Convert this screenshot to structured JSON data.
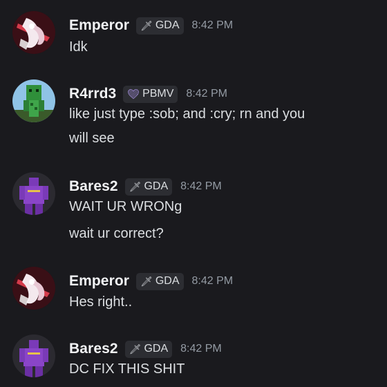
{
  "messages": [
    {
      "username": "Emperor",
      "tag_icon": "sword-icon",
      "tag": "GDA",
      "time": "8:42 PM",
      "lines": [
        "Idk"
      ]
    },
    {
      "username": "R4rrd3",
      "tag_icon": "heart-icon",
      "tag": "PBMV",
      "time": "8:42 PM",
      "lines": [
        "like just type :sob; and :cry; rn and you",
        "will see"
      ]
    },
    {
      "username": "Bares2",
      "tag_icon": "sword-icon",
      "tag": "GDA",
      "time": "8:42 PM",
      "lines": [
        "WAIT UR WRONg",
        "wait ur correct?"
      ]
    },
    {
      "username": "Emperor",
      "tag_icon": "sword-icon",
      "tag": "GDA",
      "time": "8:42 PM",
      "lines": [
        "Hes right.."
      ]
    },
    {
      "username": "Bares2",
      "tag_icon": "sword-icon",
      "tag": "GDA",
      "time": "8:42 PM",
      "lines": [
        "DC FIX THIS SHIT"
      ]
    }
  ],
  "colors": {
    "background": "#1a1a1e",
    "username": "#f2f3f5",
    "text": "#dbdee1",
    "timestamp": "#949ba4",
    "tag_bg": "#2c2d32"
  }
}
